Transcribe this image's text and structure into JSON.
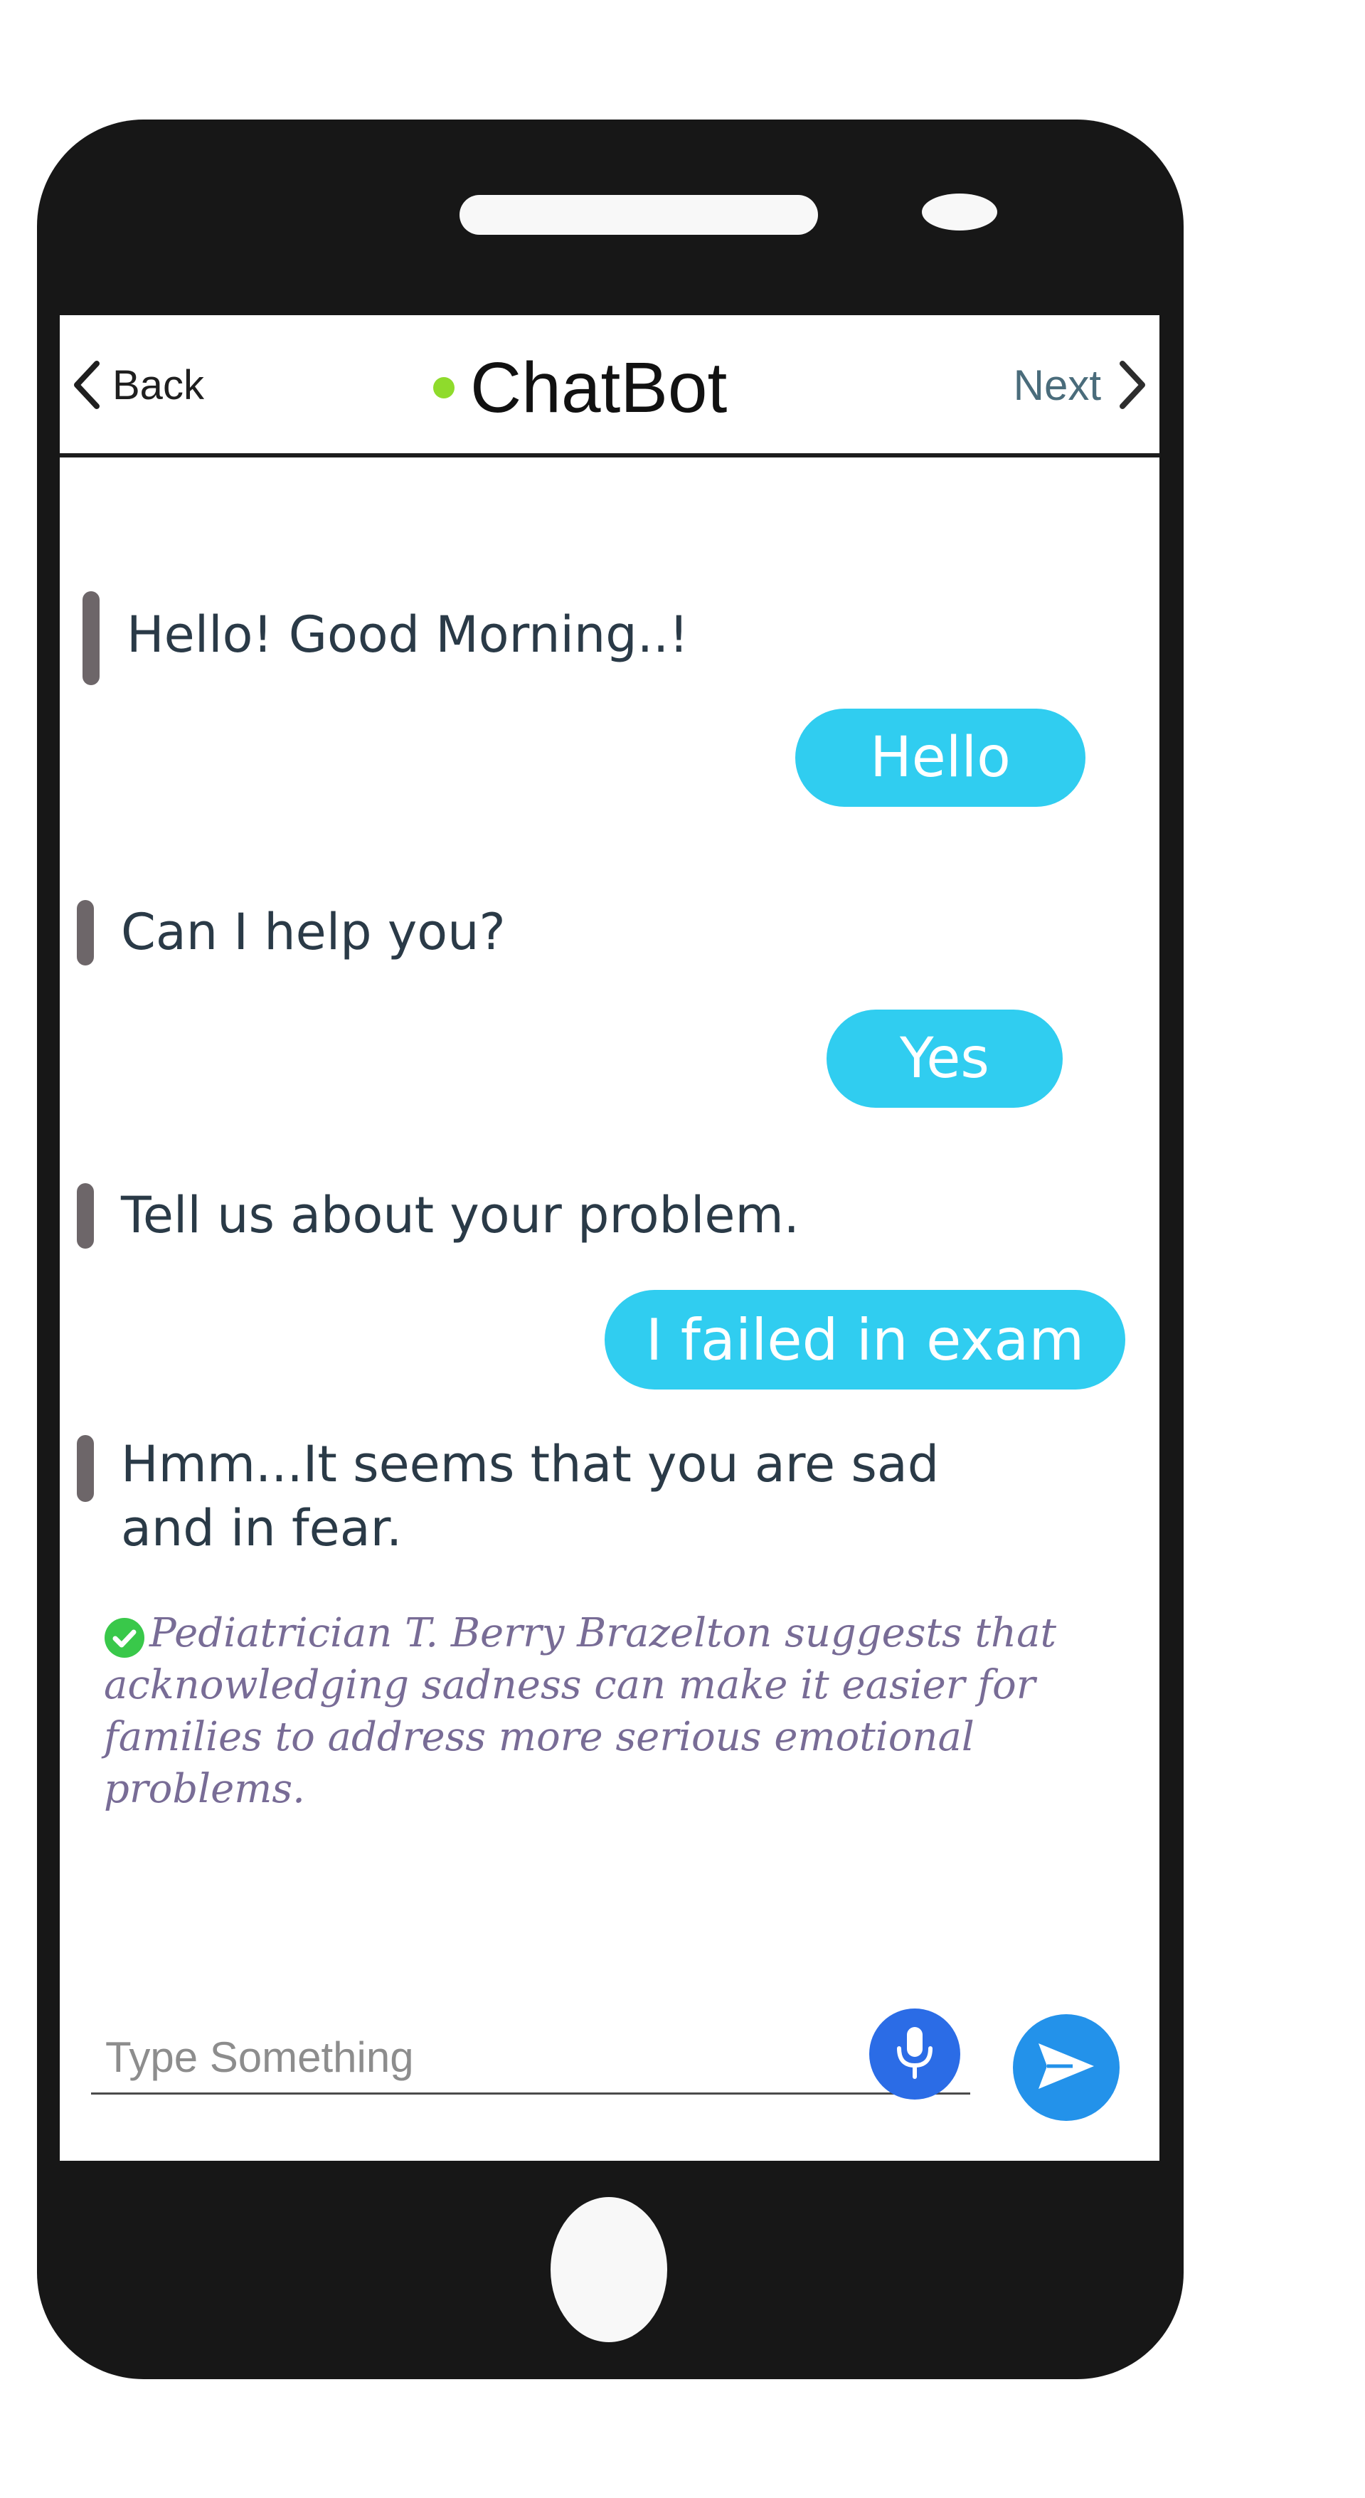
{
  "header": {
    "back_label": "Back",
    "title": "ChatBot",
    "next_label": "Next",
    "status_color": "#8fdb2c"
  },
  "messages": [
    {
      "sender": "bot",
      "text": "Hello! Good Morning..!"
    },
    {
      "sender": "user",
      "text": "Hello"
    },
    {
      "sender": "bot",
      "text": "Can I help you?"
    },
    {
      "sender": "user",
      "text": "Yes"
    },
    {
      "sender": "bot",
      "text": "Tell us about your problem."
    },
    {
      "sender": "user",
      "text": "I failed in exam"
    },
    {
      "sender": "bot",
      "lines": [
        "Hmm...It seems that you are sad",
        "and in fear."
      ]
    }
  ],
  "tip": {
    "text": "Pediatrician T. Berry Brazelton suggests that acknowledging sadness can make it easier for families to address more serious emotional problems.",
    "icon": "check-circle-icon"
  },
  "composer": {
    "placeholder": "Type Something",
    "mic_icon": "microphone-icon",
    "send_icon": "send-icon"
  },
  "colors": {
    "user_bubble": "#30cdf0",
    "bot_bar": "#6d6669",
    "mic_button": "#2b6ce6",
    "send_button": "#2392ea",
    "tip_text": "#786c96"
  }
}
